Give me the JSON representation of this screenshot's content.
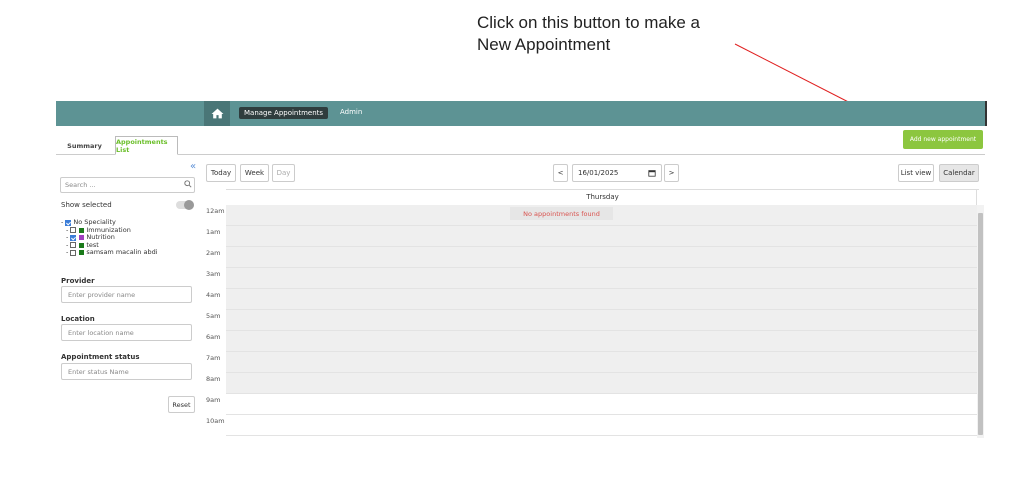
{
  "annotation": {
    "text": "Click on this button to make a\nNew Appointment"
  },
  "topnav": {
    "manage": "Manage Appointments",
    "admin": "Admin"
  },
  "tabs": {
    "summary": "Summary",
    "list": "Appointments List"
  },
  "add_button": "Add new appointment",
  "sidebar": {
    "collapse": "«",
    "search_placeholder": "Search ...",
    "show_selected": "Show selected",
    "tree": [
      {
        "prefix": "-",
        "checked": true,
        "color": "",
        "label": "No Speciality"
      },
      {
        "prefix": "-",
        "checked": false,
        "color": "#1a7a1a",
        "label": "Immunization"
      },
      {
        "prefix": "-",
        "checked": true,
        "color": "#a040c0",
        "label": "Nutrition"
      },
      {
        "prefix": "-",
        "checked": false,
        "color": "#1a7a1a",
        "label": "test"
      },
      {
        "prefix": "-",
        "checked": false,
        "color": "#1a7a1a",
        "label": "samsam macalin abdi"
      }
    ],
    "provider_label": "Provider",
    "provider_placeholder": "Enter provider name",
    "location_label": "Location",
    "location_placeholder": "Enter location name",
    "status_label": "Appointment status",
    "status_placeholder": "Enter status Name",
    "reset": "Reset"
  },
  "calendar": {
    "today": "Today",
    "week": "Week",
    "day": "Day",
    "prev": "<",
    "next": ">",
    "date": "16/01/2025",
    "list_view": "List view",
    "calendar": "Calendar",
    "day_header": "Thursday",
    "no_appointments": "No appointments found",
    "hours": [
      "12am",
      "1am",
      "2am",
      "3am",
      "4am",
      "5am",
      "6am",
      "7am",
      "8am",
      "9am",
      "10am"
    ]
  },
  "colors": {
    "topbar": "#5d9394",
    "add_button": "#8cc63f",
    "active_tab_text": "#6bbf2a",
    "no_appt_text": "#d9534f",
    "arrow": "#e02020"
  }
}
